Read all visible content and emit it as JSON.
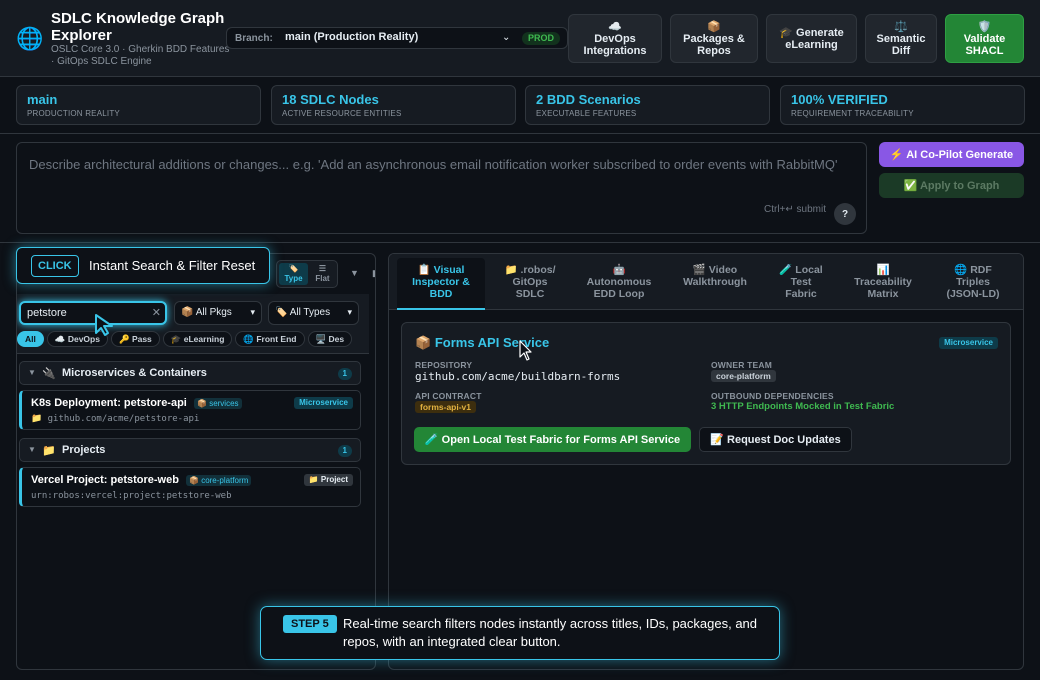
{
  "header": {
    "title": "SDLC Knowledge Graph Explorer",
    "subtitle": "OSLC Core 3.0 · Gherkin BDD Features · GitOps SDLC Engine",
    "branch_label": "Branch:",
    "branch_value": "main (Production Reality)",
    "branch_badge": "PROD",
    "buttons": [
      {
        "icon": "☁️",
        "label": "DevOps\nIntegrations"
      },
      {
        "icon": "📦",
        "label": "Packages &\nRepos"
      },
      {
        "icon": "🎓",
        "label": "Generate\neLearning"
      },
      {
        "icon": "⚖️",
        "label": "Semantic\nDiff"
      },
      {
        "icon": "🛡️",
        "label": "Validate\nSHACL"
      }
    ]
  },
  "stats": [
    {
      "value": "main",
      "label": "PRODUCTION REALITY"
    },
    {
      "value": "18 SDLC Nodes",
      "label": "ACTIVE RESOURCE ENTITIES"
    },
    {
      "value": "2 BDD Scenarios",
      "label": "EXECUTABLE FEATURES"
    },
    {
      "value": "100% VERIFIED",
      "label": "REQUIREMENT TRACEABILITY"
    }
  ],
  "prompt": {
    "placeholder": "Describe architectural additions or changes... e.g. 'Add an asynchronous email notification worker subscribed to order events with RabbitMQ'",
    "hint": "Ctrl+↵ submit",
    "help": "?",
    "copilot_label": "⚡ AI Co-Pilot Generate",
    "apply_label": "✅ Apply to Graph"
  },
  "left": {
    "view_type": "Type",
    "view_flat": "Flat",
    "search_value": "petstore",
    "pkg_select": "All Pkgs",
    "type_select": "All Types",
    "chips": [
      "All",
      "DevOps",
      "Pass",
      "eLearning",
      "Front End",
      "Des"
    ],
    "groups": [
      {
        "label": "Microservices & Containers",
        "count": "1"
      },
      {
        "label": "Projects",
        "count": "1"
      }
    ],
    "nodes": [
      {
        "title": "K8s Deployment: petstore-api",
        "pkg": "services",
        "type": "Microservice",
        "sub": "github.com/acme/petstore-api"
      },
      {
        "title": "Vercel Project: petstore-web",
        "pkg": "core-platform",
        "type": "Project",
        "sub": "urn:robos:vercel:project:petstore-web"
      }
    ]
  },
  "right": {
    "tabs": [
      "Visual\nInspector &\nBDD",
      ".robos/\nGitOps\nSDLC",
      "Autonomous\nEDD Loop",
      "Video\nWalkthrough",
      "Local\nTest\nFabric",
      "Traceability\nMatrix",
      "RDF\nTriples\n(JSON-LD)"
    ],
    "card": {
      "title": "Forms API Service",
      "badge": "Microservice",
      "repo_label": "REPOSITORY",
      "repo_value": "github.com/acme/buildbarn-forms",
      "owner_label": "OWNER TEAM",
      "owner_value": "core-platform",
      "contract_label": "API CONTRACT",
      "contract_value": "forms-api-v1",
      "deps_label": "OUTBOUND DEPENDENCIES",
      "deps_value": "3 HTTP Endpoints Mocked in Test Fabric",
      "btn_fabric": "🧪 Open Local Test Fabric for Forms API Service",
      "btn_docs": "📝 Request Doc Updates"
    }
  },
  "overlay": {
    "click_tag": "CLICK",
    "tip_text": "Instant Search & Filter Reset",
    "step_tag": "STEP 5",
    "step_text": "Real-time search filters nodes instantly across titles, IDs, packages, and repos, with an integrated clear button."
  },
  "colors": {
    "accent": "#39c5e8",
    "green": "#238636",
    "purple": "#8957e5",
    "background": "#0d1117"
  }
}
